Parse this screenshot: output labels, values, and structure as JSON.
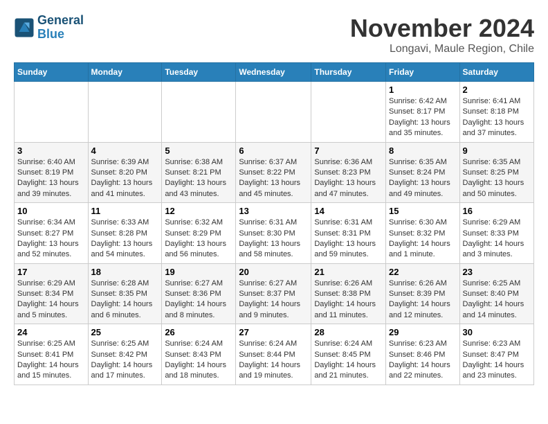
{
  "header": {
    "logo_line1": "General",
    "logo_line2": "Blue",
    "month": "November 2024",
    "location": "Longavi, Maule Region, Chile"
  },
  "weekdays": [
    "Sunday",
    "Monday",
    "Tuesday",
    "Wednesday",
    "Thursday",
    "Friday",
    "Saturday"
  ],
  "weeks": [
    [
      {
        "day": "",
        "info": ""
      },
      {
        "day": "",
        "info": ""
      },
      {
        "day": "",
        "info": ""
      },
      {
        "day": "",
        "info": ""
      },
      {
        "day": "",
        "info": ""
      },
      {
        "day": "1",
        "info": "Sunrise: 6:42 AM\nSunset: 8:17 PM\nDaylight: 13 hours and 35 minutes."
      },
      {
        "day": "2",
        "info": "Sunrise: 6:41 AM\nSunset: 8:18 PM\nDaylight: 13 hours and 37 minutes."
      }
    ],
    [
      {
        "day": "3",
        "info": "Sunrise: 6:40 AM\nSunset: 8:19 PM\nDaylight: 13 hours and 39 minutes."
      },
      {
        "day": "4",
        "info": "Sunrise: 6:39 AM\nSunset: 8:20 PM\nDaylight: 13 hours and 41 minutes."
      },
      {
        "day": "5",
        "info": "Sunrise: 6:38 AM\nSunset: 8:21 PM\nDaylight: 13 hours and 43 minutes."
      },
      {
        "day": "6",
        "info": "Sunrise: 6:37 AM\nSunset: 8:22 PM\nDaylight: 13 hours and 45 minutes."
      },
      {
        "day": "7",
        "info": "Sunrise: 6:36 AM\nSunset: 8:23 PM\nDaylight: 13 hours and 47 minutes."
      },
      {
        "day": "8",
        "info": "Sunrise: 6:35 AM\nSunset: 8:24 PM\nDaylight: 13 hours and 49 minutes."
      },
      {
        "day": "9",
        "info": "Sunrise: 6:35 AM\nSunset: 8:25 PM\nDaylight: 13 hours and 50 minutes."
      }
    ],
    [
      {
        "day": "10",
        "info": "Sunrise: 6:34 AM\nSunset: 8:27 PM\nDaylight: 13 hours and 52 minutes."
      },
      {
        "day": "11",
        "info": "Sunrise: 6:33 AM\nSunset: 8:28 PM\nDaylight: 13 hours and 54 minutes."
      },
      {
        "day": "12",
        "info": "Sunrise: 6:32 AM\nSunset: 8:29 PM\nDaylight: 13 hours and 56 minutes."
      },
      {
        "day": "13",
        "info": "Sunrise: 6:31 AM\nSunset: 8:30 PM\nDaylight: 13 hours and 58 minutes."
      },
      {
        "day": "14",
        "info": "Sunrise: 6:31 AM\nSunset: 8:31 PM\nDaylight: 13 hours and 59 minutes."
      },
      {
        "day": "15",
        "info": "Sunrise: 6:30 AM\nSunset: 8:32 PM\nDaylight: 14 hours and 1 minute."
      },
      {
        "day": "16",
        "info": "Sunrise: 6:29 AM\nSunset: 8:33 PM\nDaylight: 14 hours and 3 minutes."
      }
    ],
    [
      {
        "day": "17",
        "info": "Sunrise: 6:29 AM\nSunset: 8:34 PM\nDaylight: 14 hours and 5 minutes."
      },
      {
        "day": "18",
        "info": "Sunrise: 6:28 AM\nSunset: 8:35 PM\nDaylight: 14 hours and 6 minutes."
      },
      {
        "day": "19",
        "info": "Sunrise: 6:27 AM\nSunset: 8:36 PM\nDaylight: 14 hours and 8 minutes."
      },
      {
        "day": "20",
        "info": "Sunrise: 6:27 AM\nSunset: 8:37 PM\nDaylight: 14 hours and 9 minutes."
      },
      {
        "day": "21",
        "info": "Sunrise: 6:26 AM\nSunset: 8:38 PM\nDaylight: 14 hours and 11 minutes."
      },
      {
        "day": "22",
        "info": "Sunrise: 6:26 AM\nSunset: 8:39 PM\nDaylight: 14 hours and 12 minutes."
      },
      {
        "day": "23",
        "info": "Sunrise: 6:25 AM\nSunset: 8:40 PM\nDaylight: 14 hours and 14 minutes."
      }
    ],
    [
      {
        "day": "24",
        "info": "Sunrise: 6:25 AM\nSunset: 8:41 PM\nDaylight: 14 hours and 15 minutes."
      },
      {
        "day": "25",
        "info": "Sunrise: 6:25 AM\nSunset: 8:42 PM\nDaylight: 14 hours and 17 minutes."
      },
      {
        "day": "26",
        "info": "Sunrise: 6:24 AM\nSunset: 8:43 PM\nDaylight: 14 hours and 18 minutes."
      },
      {
        "day": "27",
        "info": "Sunrise: 6:24 AM\nSunset: 8:44 PM\nDaylight: 14 hours and 19 minutes."
      },
      {
        "day": "28",
        "info": "Sunrise: 6:24 AM\nSunset: 8:45 PM\nDaylight: 14 hours and 21 minutes."
      },
      {
        "day": "29",
        "info": "Sunrise: 6:23 AM\nSunset: 8:46 PM\nDaylight: 14 hours and 22 minutes."
      },
      {
        "day": "30",
        "info": "Sunrise: 6:23 AM\nSunset: 8:47 PM\nDaylight: 14 hours and 23 minutes."
      }
    ]
  ]
}
